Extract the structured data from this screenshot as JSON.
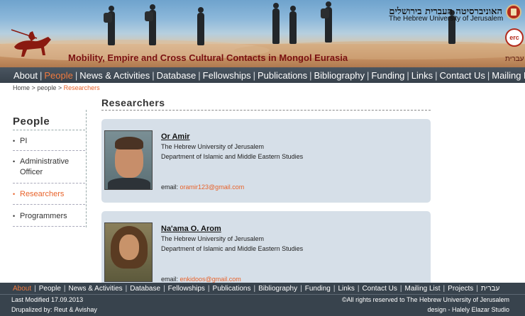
{
  "header": {
    "hebrew_university_hebrew": "האוניברסיטה העברית בירושלים",
    "hebrew_university_english": "The Hebrew University of Jerusalem",
    "erc_logo": "erc",
    "project_title": "Mobility, Empire and Cross Cultural Contacts in Mongol Eurasia",
    "language_link": "עברית"
  },
  "main_nav": {
    "items": [
      "About",
      "People",
      "News & Activities",
      "Database",
      "Fellowships",
      "Publications",
      "Bibliography",
      "Funding",
      "Links",
      "Contact Us",
      "Mailing List"
    ],
    "active": "People",
    "separator": "|"
  },
  "breadcrumb": {
    "home": "Home",
    "sep": ">",
    "people": "people",
    "current": "Researchers"
  },
  "sidebar": {
    "title": "People",
    "items": [
      {
        "label": "PI"
      },
      {
        "label": "Administrative Officer"
      },
      {
        "label": "Researchers"
      },
      {
        "label": "Programmers"
      }
    ],
    "active": "Researchers"
  },
  "content": {
    "title": "Researchers",
    "researchers": [
      {
        "name": "Or Amir",
        "institution": "The Hebrew University of Jerusalem",
        "department": "Department of Islamic and Middle Eastern Studies",
        "email_label": "email:",
        "email": "oramir123@gmail.com"
      },
      {
        "name": "Na'ama O. Arom",
        "institution": "The Hebrew University of Jerusalem",
        "department": "Department of Islamic and Middle Eastern Studies",
        "email_label": "email:",
        "email": "enkidoos@gmail.com"
      }
    ]
  },
  "footer": {
    "nav": [
      "About",
      "People",
      "News & Activities",
      "Database",
      "Fellowships",
      "Publications",
      "Bibliography",
      "Funding",
      "Links",
      "Contact Us",
      "Mailing List",
      "Projects",
      "עברית"
    ],
    "active": "About",
    "last_modified": "Last Modified 17.09.2013",
    "drupalized": "Drupalized by: Reut & Avishay",
    "copyright": "©All rights reserved to The Hebrew University of Jerusalem",
    "design": "design - Halely Elazar Studio"
  },
  "colors": {
    "accent": "#e8632b",
    "nav_bg": "#3f4a54",
    "card_bg": "#d6dfe8",
    "title_red": "#7a1010"
  }
}
